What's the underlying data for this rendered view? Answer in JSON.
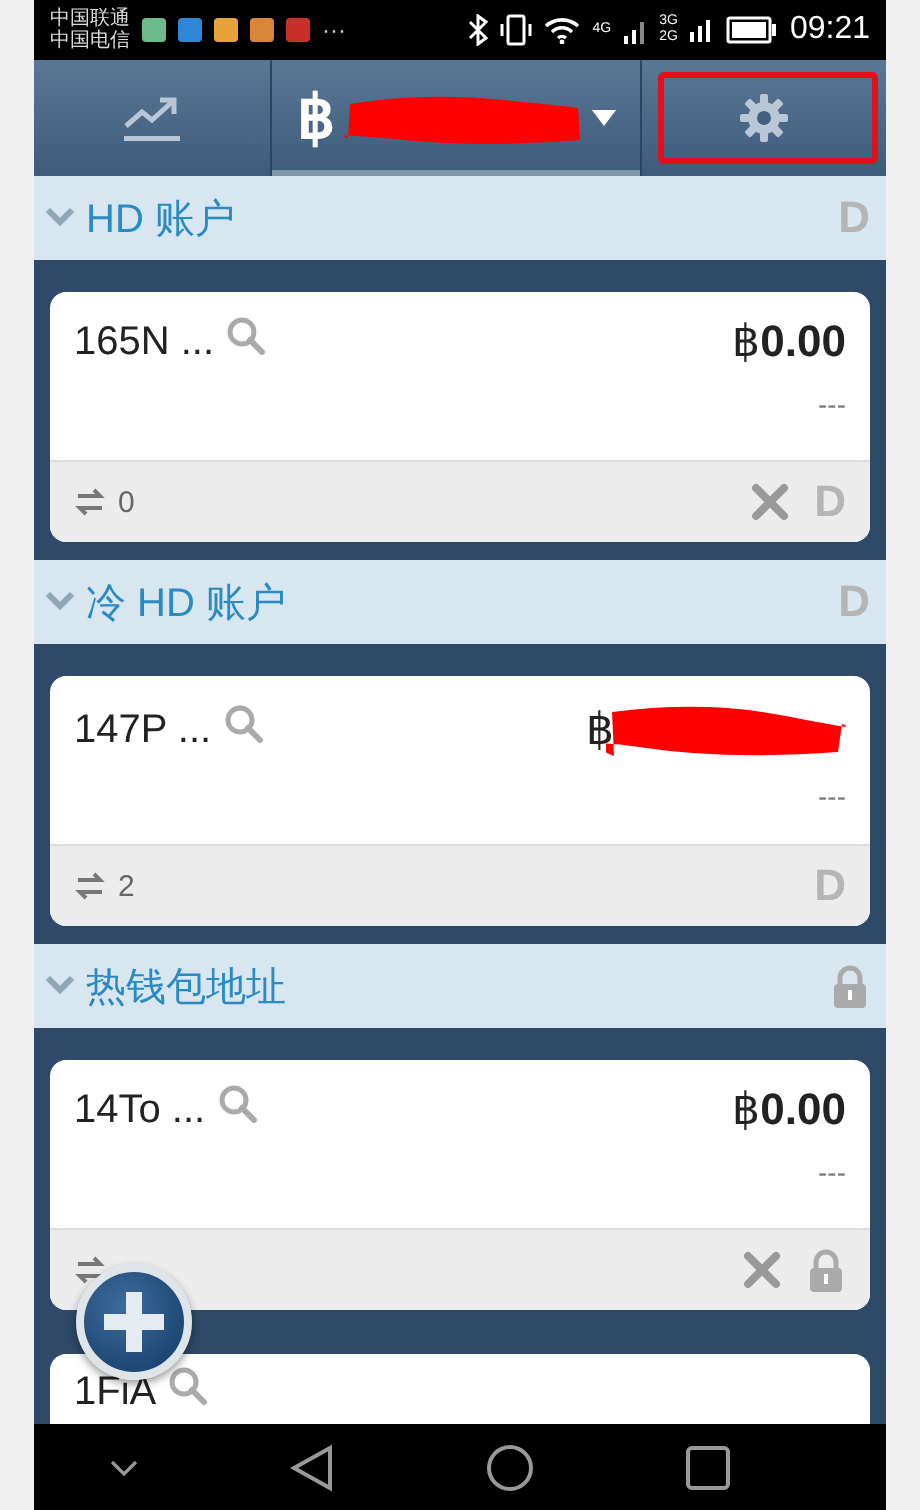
{
  "status_bar": {
    "carriers": [
      "中国联通",
      "中国电信"
    ],
    "app_icons": [
      {
        "color": "#6dbb8a"
      },
      {
        "color": "#2f86d6"
      },
      {
        "color": "#e8a23a"
      },
      {
        "color": "#d9863a"
      },
      {
        "color": "#c9302c"
      }
    ],
    "more": "···",
    "network_labels": [
      "4G",
      "3G",
      "2G"
    ],
    "time": "09:21"
  },
  "tabs": [
    {
      "kind": "chart",
      "selected": false,
      "highlighted": false
    },
    {
      "kind": "wallet",
      "symbol": "฿",
      "redacted": true,
      "selected": true,
      "highlighted": false
    },
    {
      "kind": "settings",
      "selected": false,
      "highlighted": true
    }
  ],
  "sections": [
    {
      "title": "HD 账户",
      "badge": {
        "kind": "letter",
        "text": "D"
      },
      "cards": [
        {
          "address": "165N ...",
          "balance": "฿**0.00**",
          "redacted": false,
          "change": "---",
          "tx_count": "0",
          "footer_icons": [
            {
              "kind": "x"
            },
            {
              "kind": "letter",
              "text": "D"
            }
          ]
        }
      ]
    },
    {
      "title": "冷 HD 账户",
      "badge": {
        "kind": "letter",
        "text": "D"
      },
      "cards": [
        {
          "address": "147P ...",
          "balance": "฿",
          "redacted": true,
          "change": "---",
          "tx_count": "2",
          "footer_icons": [
            {
              "kind": "letter",
              "text": "D"
            }
          ]
        }
      ]
    },
    {
      "title": "热钱包地址",
      "badge": {
        "kind": "lock"
      },
      "cards": [
        {
          "address": "14To ...",
          "balance": "฿**0.00**",
          "redacted": false,
          "change": "---",
          "footer_icons": [
            {
              "kind": "x"
            },
            {
              "kind": "lock"
            }
          ]
        },
        {
          "address": "1FiA",
          "partial": true
        }
      ]
    }
  ],
  "nav_bar": [
    {
      "kind": "hide"
    },
    {
      "kind": "back"
    },
    {
      "kind": "home"
    },
    {
      "kind": "recent"
    }
  ]
}
